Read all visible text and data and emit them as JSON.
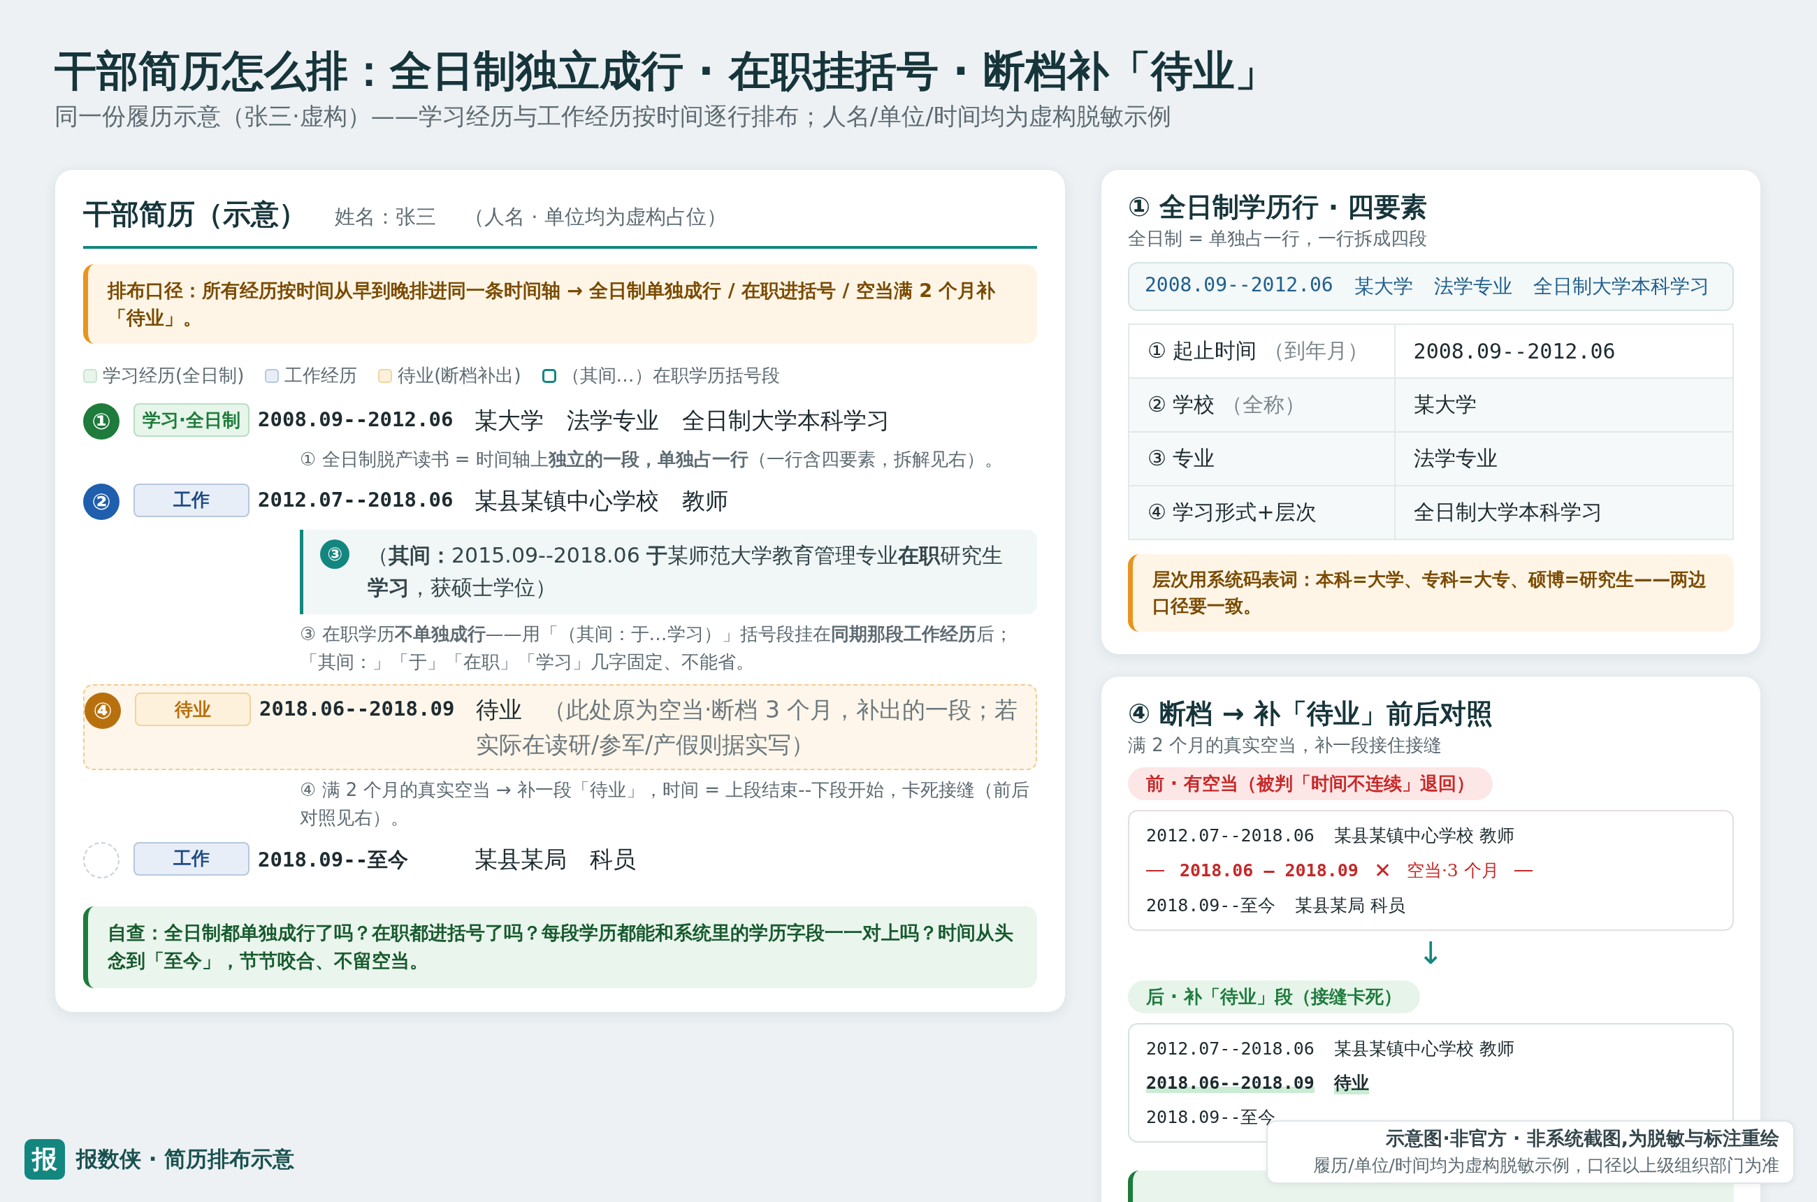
{
  "title": "干部简历怎么排：全日制独立成行 · 在职挂括号 · 断档补「待业」",
  "subtitle": "同一份履历示意（张三·虚构）——学习经历与工作经历按时间逐行排布；人名/单位/时间均为虚构脱敏示例",
  "resume_card": {
    "title": "干部简历（示意）",
    "name": "姓名：张三",
    "note": "（人名 · 单位均为虚构占位）",
    "rule_note": "排布口径：所有经历按时间从早到晚排进同一条时间轴 → 全日制单独成行 / 在职进括号 / 空当满 2 个月补「待业」。",
    "legend": [
      {
        "kind": "study",
        "label": "学习经历(全日制)"
      },
      {
        "kind": "work",
        "label": "工作经历"
      },
      {
        "kind": "idle",
        "label": "待业(断档补出)"
      },
      {
        "kind": "bracket",
        "label": "（其间…）在职学历括号段"
      }
    ],
    "entries": [
      {
        "kind": "study",
        "marker": "①",
        "tag": "学习·全日制",
        "period": "2008.09--2012.06",
        "text": "某大学　法学专业　全日制大学本科学习",
        "annotation": "① 全日制脱产读书 = 时间轴上**独立的一段，单独占一行**（一行含四要素，拆解见右）。"
      },
      {
        "kind": "work",
        "marker": "②",
        "tag": "工作",
        "period": "2012.07--2018.06",
        "text": "某县某镇中心学校　教师",
        "bracket": {
          "marker": "③",
          "text": "（**其间：**2015.09--2018.06 **于**某师范大学教育管理专业**在职**研究生**学习**，获硕士学位）"
        },
        "annotation": "③ 在职学历**不单独成行**——用「（其间：于…学习）」括号段挂在**同期那段工作经历**后；「其间：」「于」「在职」「学习」几字固定、不能省。"
      },
      {
        "kind": "idle",
        "marker": "④",
        "tag": "待业",
        "period": "2018.06--2018.09",
        "text": "待业",
        "remark": "（此处原为空当·断档 3 个月，补出的一段；若实际在读研/参军/产假则据实写）",
        "annotation": "④ 满 2 个月的真实空当 → 补一段「待业」，时间 = 上段结束--下段开始，卡死接缝（前后对照见右）。"
      },
      {
        "kind": "work",
        "tag": "工作",
        "period": "2018.09--至今",
        "text": "某县某局　科员"
      }
    ],
    "self_check": "自查：全日制都单独成行了吗？在职都进括号了吗？每段学历都能和系统里的学历字段一一对上吗？时间从头念到「至今」，节节咬合、不留空当。"
  },
  "elements_card": {
    "title": "① 全日制学历行 · 四要素",
    "subtitle": "全日制 = 单独占一行，一行拆成四段",
    "example": [
      "2008.09--2012.06",
      "某大学",
      "法学专业",
      "全日制大学本科学习"
    ],
    "rows": [
      {
        "kind": "date",
        "label": "① 起止时间",
        "hint": "（到年月）",
        "value": "2008.09--2012.06"
      },
      {
        "kind": "text",
        "label": "② 学校",
        "hint": "（全称）",
        "value": "某大学"
      },
      {
        "kind": "text",
        "label": "③ 专业",
        "value": "法学专业"
      },
      {
        "kind": "text",
        "label": "④ 学习形式+层次",
        "value": "全日制大学本科学习"
      }
    ],
    "note": "层次用系统码表词：本科=大学、专科=大专、硕博=研究生——两边口径要一致。"
  },
  "compare_card": {
    "title": "④ 断档 → 补「待业」前后对照",
    "subtitle": "满 2 个月的真实空当，补一段接住接缝",
    "before": {
      "label": "前 · 有空当（被判「时间不连续」退回）",
      "lines": [
        {
          "kind": "entry",
          "period": "2012.07--2018.06",
          "text": "某县某镇中心学校 教师"
        },
        {
          "kind": "gap",
          "period": "2018.06 – 2018.09",
          "mark": "✕",
          "text": "空当·3 个月"
        },
        {
          "kind": "entry",
          "period": "2018.09--至今",
          "text": "某县某局 科员"
        }
      ]
    },
    "arrow": "↓",
    "after": {
      "label": "后 · 补「待业」段（接缝卡死）",
      "lines": [
        {
          "kind": "entry",
          "period": "2012.07--2018.06",
          "text": "某县某镇中心学校 教师"
        },
        {
          "kind": "filled",
          "period": "2018.06--2018.09",
          "text": "待业"
        },
        {
          "kind": "entry",
          "period": "2018.09--至今"
        }
      ]
    }
  },
  "disclaimer": {
    "title": "示意图·非官方 · 非系统截图,为脱敏与标注重绘",
    "text": "履历/单位/时间均为虚构脱敏示例，口径以上级组织部门为准"
  },
  "brand": {
    "logo": "报",
    "name": "报数侠 · 简历排布示意"
  }
}
